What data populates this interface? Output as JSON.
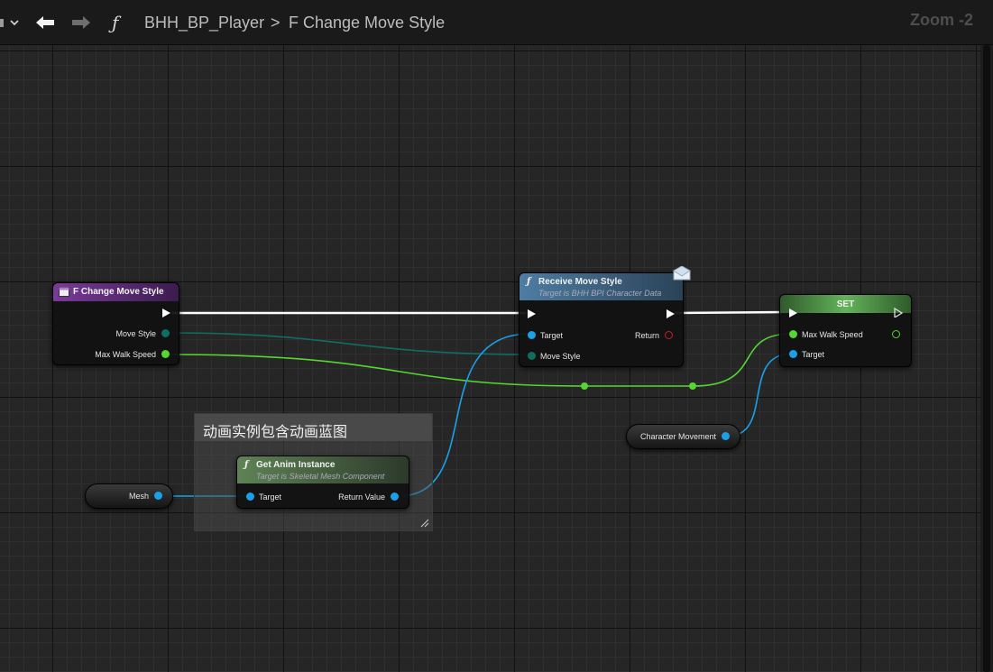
{
  "toolbar": {
    "back_icon": "back-arrow-icon",
    "forward_icon": "forward-arrow-icon",
    "function_icon": "function-icon",
    "breadcrumb_blueprint": "BHH_BP_Player",
    "breadcrumb_separator": ">",
    "breadcrumb_function": "F Change Move Style",
    "zoom_label": "Zoom -2"
  },
  "nodes": {
    "entry": {
      "title": "F Change Move Style",
      "pins": {
        "move_style": "Move Style",
        "max_walk_speed": "Max Walk Speed"
      }
    },
    "receive": {
      "title": "Receive Move Style",
      "subtitle": "Target is BHH BPI Character Data",
      "pins": {
        "target": "Target",
        "move_style": "Move Style",
        "return": "Return"
      }
    },
    "set": {
      "title": "SET",
      "pins": {
        "max_walk_speed": "Max Walk Speed",
        "target": "Target"
      }
    },
    "get_anim": {
      "title": "Get Anim Instance",
      "subtitle": "Target is Skeletal Mesh Component",
      "pins": {
        "target": "Target",
        "return_value": "Return Value"
      }
    },
    "mesh_var": {
      "label": "Mesh"
    },
    "char_move_var": {
      "label": "Character Movement"
    }
  },
  "comment": {
    "text": "动画实例包含动画蓝图"
  },
  "colors": {
    "exec": "#ffffff",
    "float_pin": "#55d630",
    "object_pin": "#1aa1e8",
    "enum_pin": "#0f6e62",
    "return_pin": "#c42323",
    "func_header_purple": "#6a2f86",
    "func_header_blue": "#3f6685",
    "set_header_green": "#3f7d38",
    "pure_header_green": "#4f6b48"
  }
}
